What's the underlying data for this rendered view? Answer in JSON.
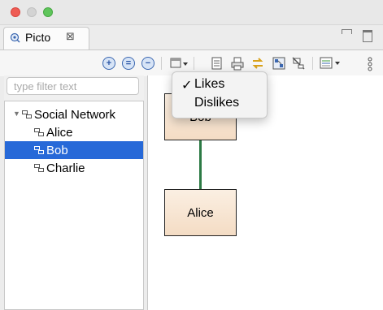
{
  "window": {
    "traffic_lights": [
      "#ee5c54",
      "#d3d3d3",
      "#5fc55b"
    ]
  },
  "view": {
    "tab_label": "Picto",
    "tab_close_glyph": "⊠",
    "tab_icon": "picto-view-icon"
  },
  "toolbar": {
    "buttons": [
      "zoom-in-icon",
      "zoom-normal-icon",
      "zoom-out-icon",
      "layout-dropdown-icon",
      "export-icon",
      "print-icon",
      "sync-icon",
      "layout-icon",
      "filter-icon",
      "view-options-icon",
      "view-menu-icon"
    ]
  },
  "filter": {
    "placeholder": "type filter text"
  },
  "tree": {
    "root": "Social Network",
    "children": [
      "Alice",
      "Bob",
      "Charlie"
    ],
    "selected": "Bob",
    "selection_color": "#2769d8"
  },
  "diagram": {
    "nodes": [
      "Bob",
      "Alice"
    ],
    "edge_color": "#2c7a45"
  },
  "menu": {
    "items": [
      {
        "label": "Likes",
        "checked": true,
        "check_glyph": "✓"
      },
      {
        "label": "Dislikes",
        "checked": false
      }
    ]
  }
}
